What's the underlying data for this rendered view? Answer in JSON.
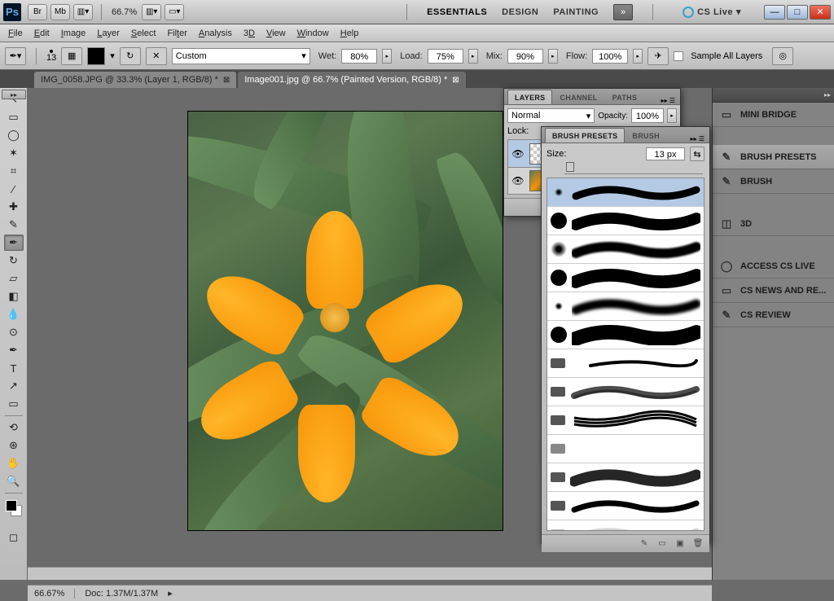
{
  "app": {
    "icon": "Ps",
    "zoom": "66.7%"
  },
  "topbar_buttons": [
    "Br",
    "Mb"
  ],
  "workspaces": {
    "items": [
      "ESSENTIALS",
      "DESIGN",
      "PAINTING"
    ],
    "active": 0
  },
  "cslive": "CS Live",
  "menus": [
    "File",
    "Edit",
    "Image",
    "Layer",
    "Select",
    "Filter",
    "Analysis",
    "3D",
    "View",
    "Window",
    "Help"
  ],
  "options": {
    "brush_size": "13",
    "preset": "Custom",
    "wet": {
      "label": "Wet:",
      "value": "80%"
    },
    "load": {
      "label": "Load:",
      "value": "75%"
    },
    "mix": {
      "label": "Mix:",
      "value": "90%"
    },
    "flow": {
      "label": "Flow:",
      "value": "100%"
    },
    "sample_all": "Sample All Layers"
  },
  "tabs": [
    {
      "title": "IMG_0058.JPG @ 33.3% (Layer 1, RGB/8) *",
      "active": false
    },
    {
      "title": "Image001.jpg @ 66.7% (Painted Version, RGB/8) *",
      "active": true
    }
  ],
  "status": {
    "zoom": "66.67%",
    "doc": "Doc: 1.37M/1.37M"
  },
  "right_panels": [
    {
      "label": "MINI BRIDGE",
      "icon": "▭"
    },
    {
      "label": "BRUSH PRESETS",
      "icon": "✎",
      "selected": true
    },
    {
      "label": "BRUSH",
      "icon": "✎"
    },
    {
      "label": "3D",
      "icon": "◫"
    },
    {
      "label": "ACCESS CS LIVE",
      "icon": "◯"
    },
    {
      "label": "CS NEWS AND RE...",
      "icon": "▭"
    },
    {
      "label": "CS REVIEW",
      "icon": "✎"
    }
  ],
  "layers_panel": {
    "tabs": [
      "LAYERS",
      "CHANNEL",
      "PATHS"
    ],
    "blend": "Normal",
    "opacity_label": "Opacity:",
    "opacity": "100%",
    "lock_label": "Lock:"
  },
  "brush_panel": {
    "tabs": [
      "BRUSH PRESETS",
      "BRUSH"
    ],
    "size_label": "Size:",
    "size_value": "13 px"
  }
}
